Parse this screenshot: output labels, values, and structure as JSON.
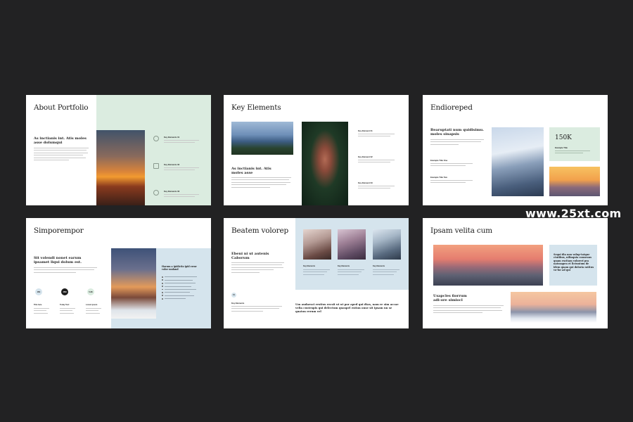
{
  "slides": {
    "s1": {
      "title": "About Portfolio",
      "heading": "As inctianis int. Atis moles asse dolumqui",
      "elements": [
        "Key Elements 01",
        "Key Elements 02",
        "Key Elements 03"
      ]
    },
    "s2": {
      "title": "Key Elements",
      "heading": "As inctianis int. Atis moles asse",
      "elements": [
        "Key Element 01",
        "Key Element 02",
        "Key Element 03"
      ]
    },
    "s3": {
      "title": "Endioreped",
      "heading": "Bearuptati num quidisimu. moles sinapsis",
      "stat_value": "150K",
      "stat_label": "Example Title",
      "examples": [
        "Example Title One",
        "Example Title Two"
      ]
    },
    "s4": {
      "title": "Simporempor",
      "heading": "Sit volendi nonet earum ipsamet liqui dolum est.",
      "stats": [
        {
          "value": "15K",
          "label": "Title here"
        },
        {
          "value": "45M",
          "label": "Today Text"
        },
        {
          "value": "5.3K",
          "label": "Lorem ipsum"
        }
      ],
      "side_heading": "Harum a ipidictio ipid error volor undand"
    },
    "s5": {
      "title": "Beatem volorep",
      "heading": "Ebeni ni ut autenis Caborum",
      "number": "01",
      "key_label": "Key Elements",
      "photo_labels": [
        "Key Elements",
        "Key Elements",
        "Key Elements"
      ],
      "quote": "Um audaesci restius recsit ut ut por aped qui dtas, nam re sim accae velia custrupis qui delectum quaspel estion onse sit ipsam un se quaton rerum vel"
    },
    "s6": {
      "title": "Ipsam velita cum",
      "side_heading": "Sequi dia non volup-tatque ctutibus, nilinquia consenus quam excitam voloreri pra natusapen et lictuntum de idem quam qui doloria ratitus vo-lor ad qui",
      "heading": "Usapcles fiorrum adi-ore simiocl"
    }
  },
  "watermark": "www.25xt.com",
  "colors": {
    "background": "#222223",
    "mint": "#dbece0",
    "light_blue": "#d5e4ed"
  }
}
